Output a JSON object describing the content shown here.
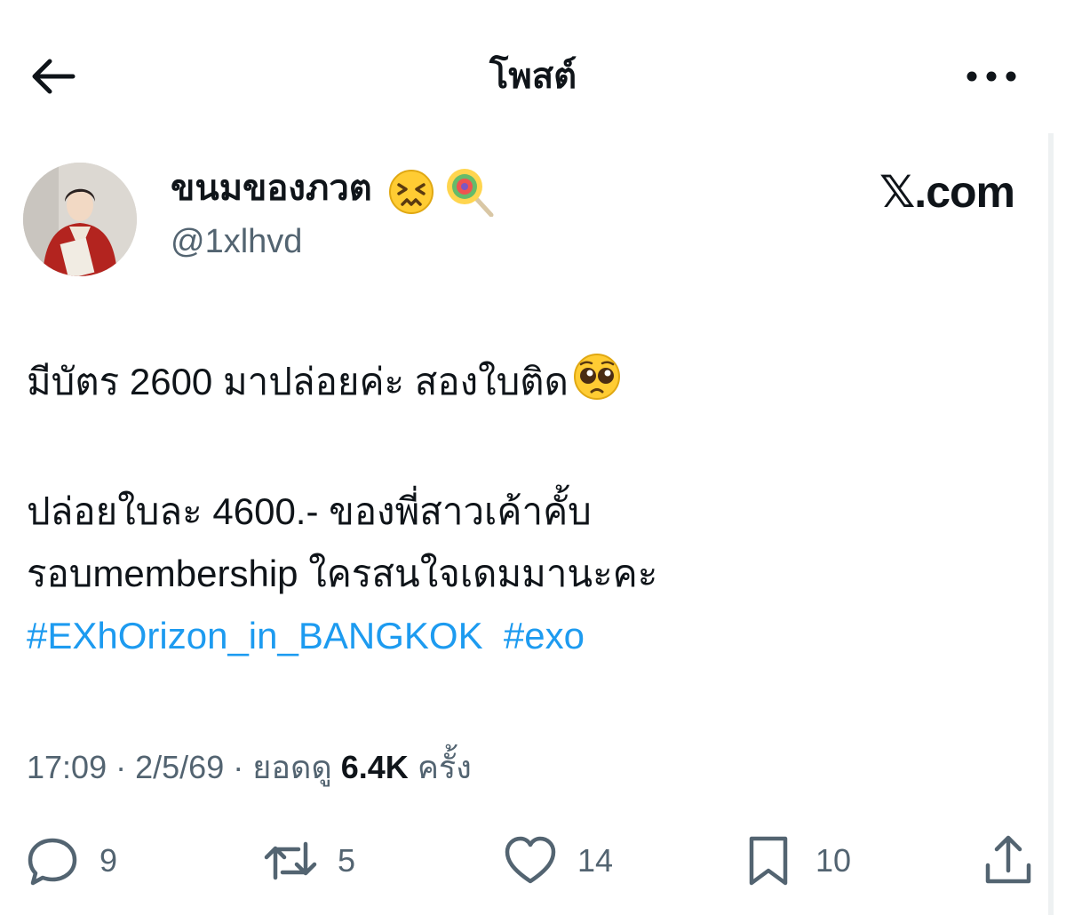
{
  "header": {
    "title": "โพสต์",
    "back_icon": "arrow-left-icon",
    "more_icon": "more-horizontal-icon"
  },
  "author": {
    "display_name": "ขนมของภวต",
    "emojis": [
      "persevering-face-emoji",
      "lollipop-emoji"
    ],
    "handle": "@1xlhvd",
    "source": "𝕏.com"
  },
  "post": {
    "line1": "มีบัตร 2600 มาปล่อยค่ะ สองใบติด",
    "line1_emoji": "pleading-face-emoji",
    "line2": "ปล่อยใบละ 4600.- ของพี่สาวเค้าคั้บ",
    "line3": "รอบmembership  ใครสนใจเดมมานะคะ",
    "hashtags": [
      "#EXhOrizon_in_BANGKOK",
      "#exo"
    ]
  },
  "meta": {
    "time": "17:09",
    "date": "2/5/69",
    "views_label": "ยอดดู",
    "views": "6.4K",
    "views_suffix": "ครั้ง",
    "separator": "·"
  },
  "actions": {
    "replies": "9",
    "reposts": "5",
    "likes": "14",
    "bookmarks": "10"
  },
  "colors": {
    "text": "#0f1419",
    "secondary": "#536471",
    "link": "#1d9bf0"
  }
}
